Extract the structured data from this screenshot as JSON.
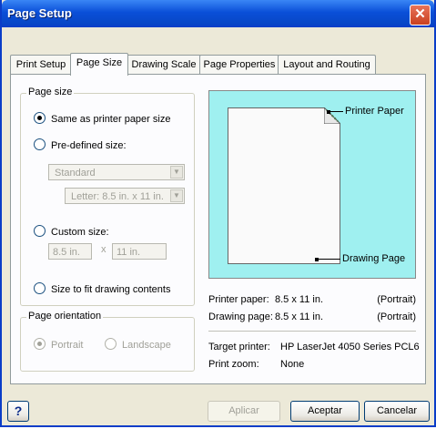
{
  "window": {
    "title": "Page Setup",
    "close_symbol": "✕"
  },
  "tabs": [
    {
      "label": "Print Setup"
    },
    {
      "label": "Page Size"
    },
    {
      "label": "Drawing Scale"
    },
    {
      "label": "Page Properties"
    },
    {
      "label": "Layout and Routing"
    }
  ],
  "active_tab": "Page Size",
  "page_size": {
    "group_label": "Page size",
    "same_as_printer": "Same as printer paper size",
    "predefined": "Pre-defined size:",
    "predefined_type": "Standard",
    "predefined_size": "Letter:  8.5 in. x 11 in.",
    "custom": "Custom size:",
    "custom_width": "8.5 in.",
    "custom_x": "x",
    "custom_height": "11 in.",
    "fit_contents": "Size to fit drawing contents",
    "selected": "same_as_printer"
  },
  "orientation": {
    "group_label": "Page orientation",
    "portrait": "Portrait",
    "landscape": "Landscape",
    "selected": "portrait"
  },
  "preview": {
    "printer_paper_label": "Printer Paper",
    "drawing_page_label": "Drawing Page",
    "background_color": "#9ff0f0"
  },
  "info": {
    "printer_paper_key": "Printer paper:",
    "printer_paper_value": "8.5 x 11 in.",
    "printer_paper_orient": "(Portrait)",
    "drawing_page_key": "Drawing page:",
    "drawing_page_value": "8.5 x 11 in.",
    "drawing_page_orient": "(Portrait)",
    "target_printer_key": "Target printer:",
    "target_printer_value": "HP LaserJet 4050 Series PCL6",
    "print_zoom_key": "Print zoom:",
    "print_zoom_value": "None"
  },
  "buttons": {
    "help": "?",
    "apply": "Aplicar",
    "ok": "Aceptar",
    "cancel": "Cancelar"
  }
}
